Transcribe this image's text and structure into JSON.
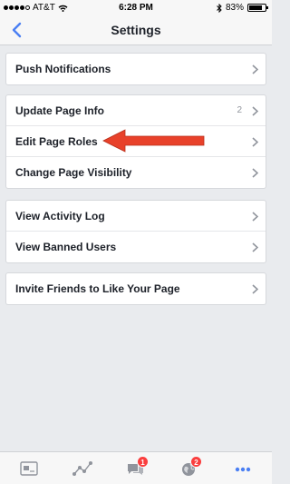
{
  "status_bar": {
    "carrier": "AT&T",
    "time": "6:28 PM",
    "battery": "83%",
    "battery_level": 0.83
  },
  "nav": {
    "title": "Settings",
    "back_icon": "chevron-left-icon"
  },
  "groups": [
    {
      "rows": [
        {
          "label": "Push Notifications"
        }
      ]
    },
    {
      "rows": [
        {
          "label": "Update Page Info",
          "count": "2"
        },
        {
          "label": "Edit Page Roles"
        },
        {
          "label": "Change Page Visibility"
        }
      ]
    },
    {
      "rows": [
        {
          "label": "View Activity Log"
        },
        {
          "label": "View Banned Users"
        }
      ]
    },
    {
      "rows": [
        {
          "label": "Invite Friends to Like Your Page"
        }
      ]
    }
  ],
  "annotation": {
    "color": "#e8412a"
  },
  "tab_bar": {
    "tabs": [
      {
        "icon": "page-card-icon"
      },
      {
        "icon": "insights-icon"
      },
      {
        "icon": "messages-icon",
        "badge": "1"
      },
      {
        "icon": "notifications-globe-icon",
        "badge": "2"
      },
      {
        "icon": "more-icon",
        "active": true
      }
    ]
  },
  "colors": {
    "accent": "#4a7ff3",
    "badge": "#fa3e3e",
    "background": "#e9ebee"
  }
}
